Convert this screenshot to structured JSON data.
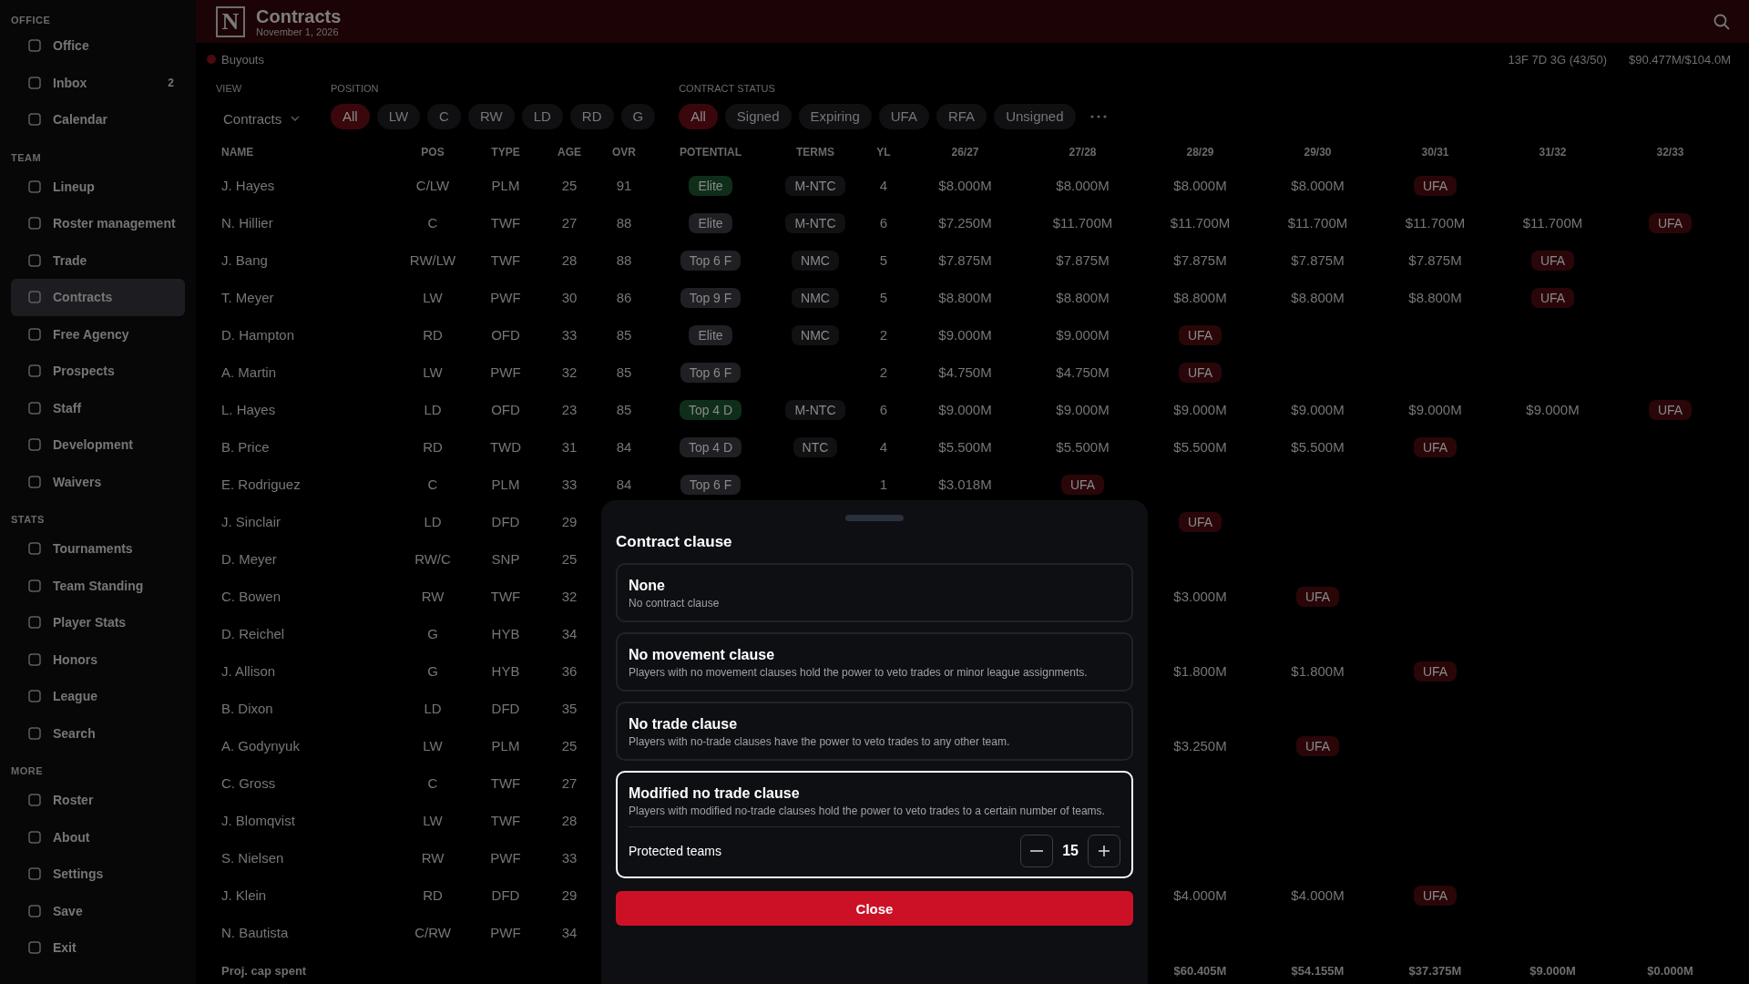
{
  "sidebar": {
    "sections": [
      {
        "title": "OFFICE",
        "items": [
          {
            "label": "Office",
            "selected": false
          },
          {
            "label": "Inbox",
            "selected": false,
            "badge": "2"
          },
          {
            "label": "Calendar",
            "selected": false
          }
        ]
      },
      {
        "title": "TEAM",
        "items": [
          {
            "label": "Lineup",
            "selected": false
          },
          {
            "label": "Roster management",
            "selected": false
          },
          {
            "label": "Trade",
            "selected": false
          },
          {
            "label": "Contracts",
            "selected": true
          },
          {
            "label": "Free Agency",
            "selected": false
          },
          {
            "label": "Prospects",
            "selected": false
          },
          {
            "label": "Staff",
            "selected": false
          },
          {
            "label": "Development",
            "selected": false
          },
          {
            "label": "Waivers",
            "selected": false
          }
        ]
      },
      {
        "title": "STATS",
        "items": [
          {
            "label": "Tournaments",
            "selected": false
          },
          {
            "label": "Team Standing",
            "selected": false
          },
          {
            "label": "Player Stats",
            "selected": false
          },
          {
            "label": "Honors",
            "selected": false
          },
          {
            "label": "League",
            "selected": false
          },
          {
            "label": "Search",
            "selected": false
          }
        ]
      },
      {
        "title": "MORE",
        "items": [
          {
            "label": "Roster",
            "selected": false
          },
          {
            "label": "About",
            "selected": false
          },
          {
            "label": "Settings",
            "selected": false
          },
          {
            "label": "Save",
            "selected": false
          },
          {
            "label": "Exit",
            "selected": false
          }
        ]
      }
    ]
  },
  "header": {
    "logo": "N",
    "title": "Contracts",
    "subtitle": "November 1, 2026"
  },
  "summary": {
    "buyouts": "Buyouts",
    "roster_count": "13F 7D 3G (43/50)",
    "cap": "$90.477M/$104.0M"
  },
  "filters": {
    "view": {
      "label": "VIEW",
      "value": "Contracts"
    },
    "position": {
      "label": "POSITION",
      "options": [
        {
          "label": "All",
          "selected": true
        },
        {
          "label": "LW",
          "selected": false
        },
        {
          "label": "C",
          "selected": false
        },
        {
          "label": "RW",
          "selected": false
        },
        {
          "label": "LD",
          "selected": false
        },
        {
          "label": "RD",
          "selected": false
        },
        {
          "label": "G",
          "selected": false
        }
      ]
    },
    "contract_status": {
      "label": "CONTRACT STATUS",
      "options": [
        {
          "label": "All",
          "selected": true
        },
        {
          "label": "Signed",
          "selected": false
        },
        {
          "label": "Expiring",
          "selected": false
        },
        {
          "label": "UFA",
          "selected": false
        },
        {
          "label": "RFA",
          "selected": false
        },
        {
          "label": "Unsigned",
          "selected": false
        }
      ]
    }
  },
  "table": {
    "columns": [
      "NAME",
      "POS",
      "TYPE",
      "AGE",
      "OVR",
      "POTENTIAL",
      "TERMS",
      "YL",
      "26/27",
      "27/28",
      "28/29",
      "29/30",
      "30/31",
      "31/32",
      "32/33"
    ],
    "rows": [
      {
        "name": "J. Hayes",
        "pos": "C/LW",
        "type": "PLM",
        "age": "25",
        "ovr": "91",
        "potential": {
          "text": "Elite",
          "color": "#0f2e19"
        },
        "terms": "M-NTC",
        "yl": "4",
        "year_1": {
          "kind": "amount",
          "text": "$8.000M"
        },
        "year_2": {
          "kind": "amount",
          "text": "$8.000M"
        },
        "year_3": {
          "kind": "amount",
          "text": "$8.000M"
        },
        "year_4": {
          "kind": "amount",
          "text": "$8.000M"
        },
        "year_5": {
          "kind": "badge",
          "text": "UFA"
        }
      },
      {
        "name": "N. Hillier",
        "pos": "C",
        "type": "TWF",
        "age": "27",
        "ovr": "88",
        "potential": {
          "text": "Elite",
          "color": "#1f1f24"
        },
        "terms": "M-NTC",
        "yl": "6",
        "year_1": {
          "kind": "amount",
          "text": "$7.250M"
        },
        "year_2": {
          "kind": "amount",
          "text": "$11.700M"
        },
        "year_3": {
          "kind": "amount",
          "text": "$11.700M"
        },
        "year_4": {
          "kind": "amount",
          "text": "$11.700M"
        },
        "year_5": {
          "kind": "amount",
          "text": "$11.700M"
        },
        "year_6": {
          "kind": "amount",
          "text": "$11.700M"
        },
        "year_7": {
          "kind": "badge",
          "text": "UFA"
        }
      },
      {
        "name": "J. Bang",
        "pos": "RW/LW",
        "type": "TWF",
        "age": "28",
        "ovr": "88",
        "potential": {
          "text": "Top 6 F",
          "color": "#1f1f24"
        },
        "terms": "NMC",
        "yl": "5",
        "year_1": {
          "kind": "amount",
          "text": "$7.875M"
        },
        "year_2": {
          "kind": "amount",
          "text": "$7.875M"
        },
        "year_3": {
          "kind": "amount",
          "text": "$7.875M"
        },
        "year_4": {
          "kind": "amount",
          "text": "$7.875M"
        },
        "year_5": {
          "kind": "amount",
          "text": "$7.875M"
        },
        "year_6": {
          "kind": "badge",
          "text": "UFA"
        }
      },
      {
        "name": "T. Meyer",
        "pos": "LW",
        "type": "PWF",
        "age": "30",
        "ovr": "86",
        "potential": {
          "text": "Top 9 F",
          "color": "#1f1f24"
        },
        "terms": "NMC",
        "yl": "5",
        "year_1": {
          "kind": "amount",
          "text": "$8.800M"
        },
        "year_2": {
          "kind": "amount",
          "text": "$8.800M"
        },
        "year_3": {
          "kind": "amount",
          "text": "$8.800M"
        },
        "year_4": {
          "kind": "amount",
          "text": "$8.800M"
        },
        "year_5": {
          "kind": "amount",
          "text": "$8.800M"
        },
        "year_6": {
          "kind": "badge",
          "text": "UFA"
        }
      },
      {
        "name": "D. Hampton",
        "pos": "RD",
        "type": "OFD",
        "age": "33",
        "ovr": "85",
        "potential": {
          "text": "Elite",
          "color": "#1f1f24"
        },
        "terms": "NMC",
        "yl": "2",
        "year_1": {
          "kind": "amount",
          "text": "$9.000M"
        },
        "year_2": {
          "kind": "amount",
          "text": "$9.000M"
        },
        "year_3": {
          "kind": "badge",
          "text": "UFA"
        }
      },
      {
        "name": "A. Martin",
        "pos": "LW",
        "type": "PWF",
        "age": "32",
        "ovr": "85",
        "potential": {
          "text": "Top 6 F",
          "color": "#1f1f24"
        },
        "yl": "2",
        "year_1": {
          "kind": "amount",
          "text": "$4.750M"
        },
        "year_2": {
          "kind": "amount",
          "text": "$4.750M"
        },
        "year_3": {
          "kind": "badge",
          "text": "UFA"
        }
      },
      {
        "name": "L. Hayes",
        "pos": "LD",
        "type": "OFD",
        "age": "23",
        "ovr": "85",
        "potential": {
          "text": "Top 4 D",
          "color": "#0f2e19"
        },
        "terms": "M-NTC",
        "yl": "6",
        "year_1": {
          "kind": "amount",
          "text": "$9.000M"
        },
        "year_2": {
          "kind": "amount",
          "text": "$9.000M"
        },
        "year_3": {
          "kind": "amount",
          "text": "$9.000M"
        },
        "year_4": {
          "kind": "amount",
          "text": "$9.000M"
        },
        "year_5": {
          "kind": "amount",
          "text": "$9.000M"
        },
        "year_6": {
          "kind": "amount",
          "text": "$9.000M"
        },
        "year_7": {
          "kind": "badge",
          "text": "UFA"
        }
      },
      {
        "name": "B. Price",
        "pos": "RD",
        "type": "TWD",
        "age": "31",
        "ovr": "84",
        "potential": {
          "text": "Top 4 D",
          "color": "#1f1f24"
        },
        "terms": "NTC",
        "yl": "4",
        "year_1": {
          "kind": "amount",
          "text": "$5.500M"
        },
        "year_2": {
          "kind": "amount",
          "text": "$5.500M"
        },
        "year_3": {
          "kind": "amount",
          "text": "$5.500M"
        },
        "year_4": {
          "kind": "amount",
          "text": "$5.500M"
        },
        "year_5": {
          "kind": "badge",
          "text": "UFA"
        }
      },
      {
        "name": "E. Rodriguez",
        "pos": "C",
        "type": "PLM",
        "age": "33",
        "ovr": "84",
        "potential": {
          "text": "Top 6 F",
          "color": "#1f1f24"
        },
        "yl": "1",
        "year_1": {
          "kind": "amount",
          "text": "$3.018M"
        },
        "year_2": {
          "kind": "badge",
          "text": "UFA"
        }
      },
      {
        "name": "J. Sinclair",
        "pos": "LD",
        "type": "DFD",
        "age": "29",
        "year_3": {
          "kind": "badge",
          "text": "UFA"
        }
      },
      {
        "name": "D. Meyer",
        "pos": "RW/C",
        "type": "SNP",
        "age": "25"
      },
      {
        "name": "C. Bowen",
        "pos": "RW",
        "type": "TWF",
        "age": "32",
        "year_3": {
          "kind": "amount",
          "text": "$3.000M"
        },
        "year_4": {
          "kind": "badge",
          "text": "UFA"
        }
      },
      {
        "name": "D. Reichel",
        "pos": "G",
        "type": "HYB",
        "age": "34"
      },
      {
        "name": "J. Allison",
        "pos": "G",
        "type": "HYB",
        "age": "36",
        "year_3": {
          "kind": "amount",
          "text": "$1.800M"
        },
        "year_4": {
          "kind": "amount",
          "text": "$1.800M"
        },
        "year_5": {
          "kind": "badge",
          "text": "UFA"
        }
      },
      {
        "name": "B. Dixon",
        "pos": "LD",
        "type": "DFD",
        "age": "35"
      },
      {
        "name": "A. Godynyuk",
        "pos": "LW",
        "type": "PLM",
        "age": "25",
        "year_3": {
          "kind": "amount",
          "text": "$3.250M"
        },
        "year_4": {
          "kind": "badge",
          "text": "UFA"
        }
      },
      {
        "name": "C. Gross",
        "pos": "C",
        "type": "TWF",
        "age": "27"
      },
      {
        "name": "J. Blomqvist",
        "pos": "LW",
        "type": "TWF",
        "age": "28"
      },
      {
        "name": "S. Nielsen",
        "pos": "RW",
        "type": "PWF",
        "age": "33"
      },
      {
        "name": "J. Klein",
        "pos": "RD",
        "type": "DFD",
        "age": "29",
        "year_3": {
          "kind": "amount",
          "text": "$4.000M"
        },
        "year_4": {
          "kind": "amount",
          "text": "$4.000M"
        },
        "year_5": {
          "kind": "badge",
          "text": "UFA"
        }
      },
      {
        "name": "N. Bautista",
        "pos": "C/RW",
        "type": "PWF",
        "age": "34"
      }
    ],
    "footer": {
      "label": "Proj. cap spent",
      "year_3": "$60.405M",
      "year_4": "$54.155M",
      "year_5": "$37.375M",
      "year_6": "$9.000M",
      "year_7": "$0.000M"
    }
  },
  "dialog": {
    "title": "Contract clause",
    "options": [
      {
        "title": "None",
        "description": "No contract clause",
        "selected": false
      },
      {
        "title": "No movement clause",
        "description": "Players with no movement clauses hold the power to veto trades or minor league assignments.",
        "selected": false
      },
      {
        "title": "No trade clause",
        "description": "Players with no-trade clauses have the power to veto trades to any other team.",
        "selected": false
      },
      {
        "title": "Modified no trade clause",
        "description": "Players with modified no-trade clauses hold the power to veto trades to a certain number of teams.",
        "selected": true,
        "stepper": {
          "label": "Protected teams",
          "value": "15"
        }
      }
    ],
    "close": "Close"
  }
}
